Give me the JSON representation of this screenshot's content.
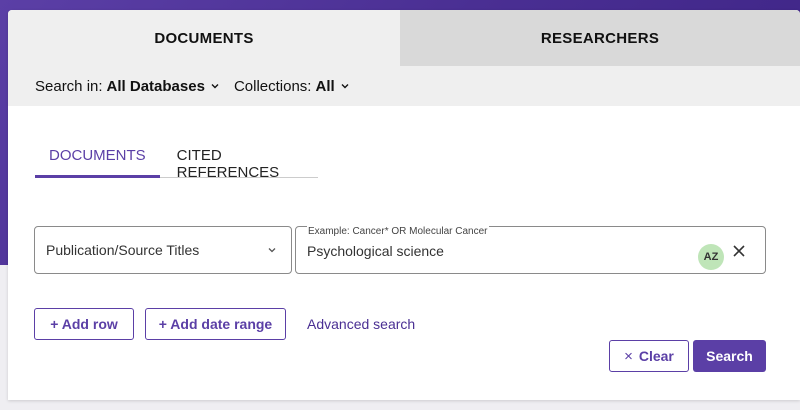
{
  "top_tabs": [
    {
      "label": "DOCUMENTS",
      "active": true
    },
    {
      "label": "RESEARCHERS",
      "active": false
    }
  ],
  "filters": {
    "search_in": {
      "label": "Search in:",
      "value": "All Databases"
    },
    "collections": {
      "label": "Collections:",
      "value": "All"
    }
  },
  "sub_tabs": [
    {
      "label": "DOCUMENTS",
      "active": true
    },
    {
      "label": "CITED REFERENCES",
      "active": false
    }
  ],
  "search_row": {
    "field": "Publication/Source Titles",
    "hint": "Example: Cancer* OR Molecular Cancer",
    "value": "Psychological science",
    "az_label": "AZ"
  },
  "actions": {
    "add_row": "+ Add row",
    "add_date_range": "+ Add date range",
    "advanced_search": "Advanced search",
    "clear": "Clear",
    "search": "Search"
  },
  "colors": {
    "accent": "#5b3fa6",
    "background_purple": "#4a2f93",
    "az_badge": "#bfe5b8"
  }
}
